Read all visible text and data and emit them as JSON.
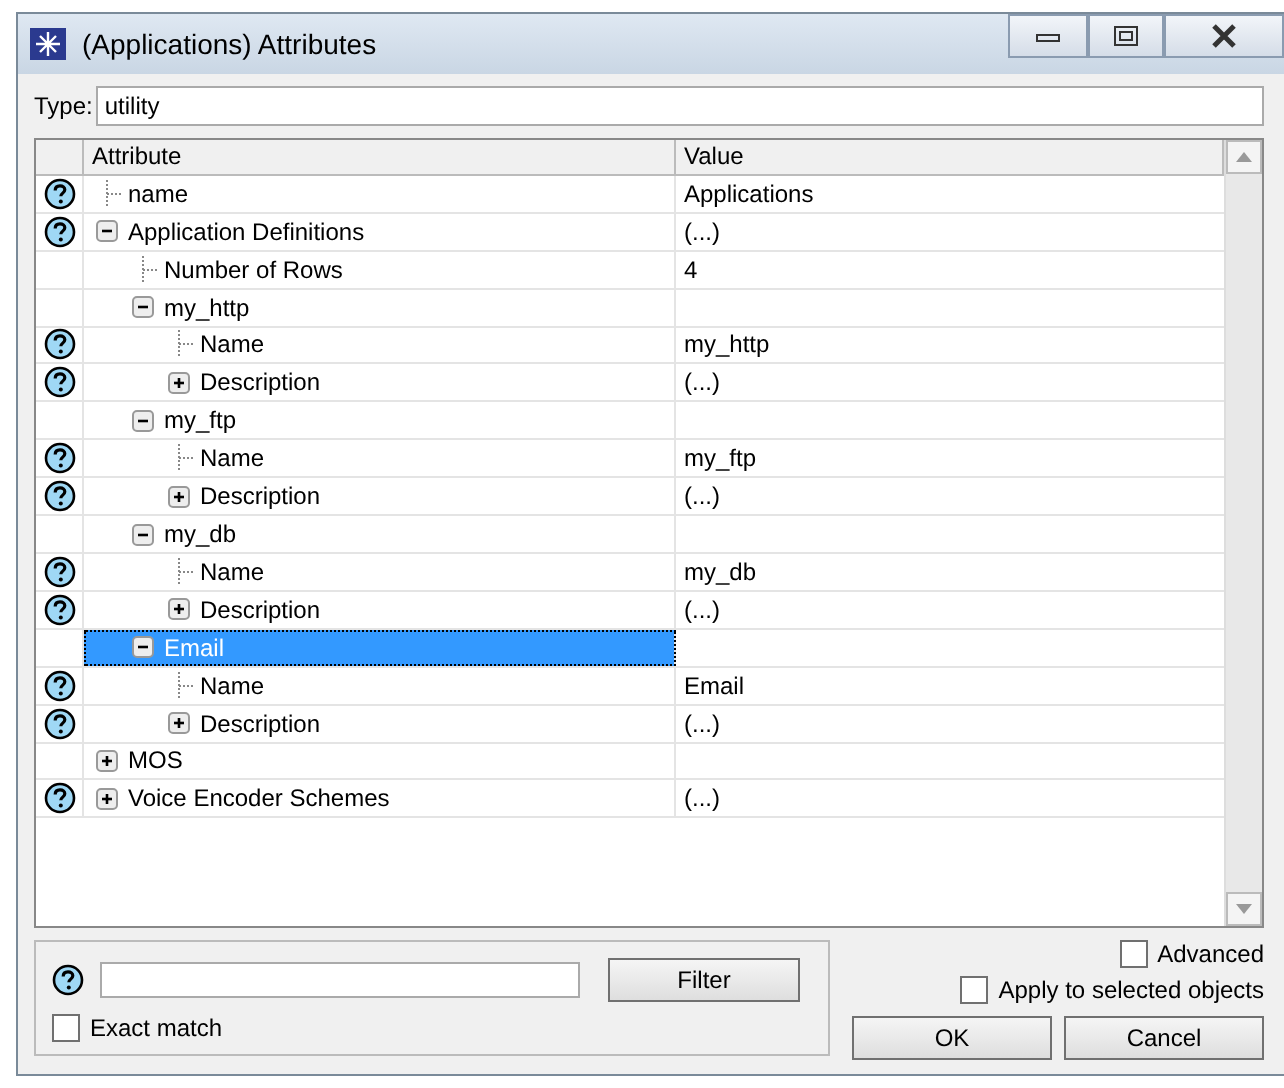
{
  "window": {
    "title": "(Applications) Attributes"
  },
  "type_field": {
    "label": "Type:",
    "value": "utility"
  },
  "table": {
    "columns": [
      "Attribute",
      "Value"
    ],
    "rows": [
      {
        "label": "name",
        "value": "Applications",
        "help": true,
        "expandable": false,
        "expanded": false,
        "selected": false
      },
      {
        "label": "Application Definitions",
        "value": "(...)",
        "help": true,
        "expandable": true,
        "expanded": true,
        "selected": false,
        "children": [
          {
            "label": "Number of Rows",
            "value": "4",
            "help": false,
            "expandable": false,
            "expanded": false,
            "selected": false
          },
          {
            "label": "my_http",
            "help": false,
            "expandable": true,
            "expanded": true,
            "selected": false,
            "children": [
              {
                "label": "Name",
                "value": "my_http",
                "help": true,
                "expandable": false,
                "expanded": false,
                "selected": false
              },
              {
                "label": "Description",
                "value": "(...)",
                "help": true,
                "expandable": true,
                "expanded": false,
                "selected": false
              }
            ]
          },
          {
            "label": "my_ftp",
            "help": false,
            "expandable": true,
            "expanded": true,
            "selected": false,
            "children": [
              {
                "label": "Name",
                "value": "my_ftp",
                "help": true,
                "expandable": false,
                "expanded": false,
                "selected": false
              },
              {
                "label": "Description",
                "value": "(...)",
                "help": true,
                "expandable": true,
                "expanded": false,
                "selected": false
              }
            ]
          },
          {
            "label": "my_db",
            "help": false,
            "expandable": true,
            "expanded": true,
            "selected": false,
            "children": [
              {
                "label": "Name",
                "value": "my_db",
                "help": true,
                "expandable": false,
                "expanded": false,
                "selected": false
              },
              {
                "label": "Description",
                "value": "(...)",
                "help": true,
                "expandable": true,
                "expanded": false,
                "selected": false
              }
            ]
          },
          {
            "label": "Email",
            "help": false,
            "expandable": true,
            "expanded": true,
            "selected": true,
            "children": [
              {
                "label": "Name",
                "value": "Email",
                "help": true,
                "expandable": false,
                "expanded": false,
                "selected": false
              },
              {
                "label": "Description",
                "value": "(...)",
                "help": true,
                "expandable": true,
                "expanded": false,
                "selected": false
              }
            ]
          }
        ]
      },
      {
        "label": "MOS",
        "help": false,
        "expandable": true,
        "expanded": false,
        "selected": false
      },
      {
        "label": "Voice Encoder Schemes",
        "value": "(...)",
        "help": true,
        "expandable": true,
        "expanded": false,
        "selected": false
      }
    ]
  },
  "filter": {
    "button": "Filter",
    "exact_match": {
      "label": "Exact match",
      "checked": false
    }
  },
  "options": [
    {
      "label": "Advanced",
      "checked": false
    },
    {
      "label": "Apply to selected objects",
      "checked": false
    }
  ],
  "buttons": [
    "OK",
    "Cancel"
  ]
}
